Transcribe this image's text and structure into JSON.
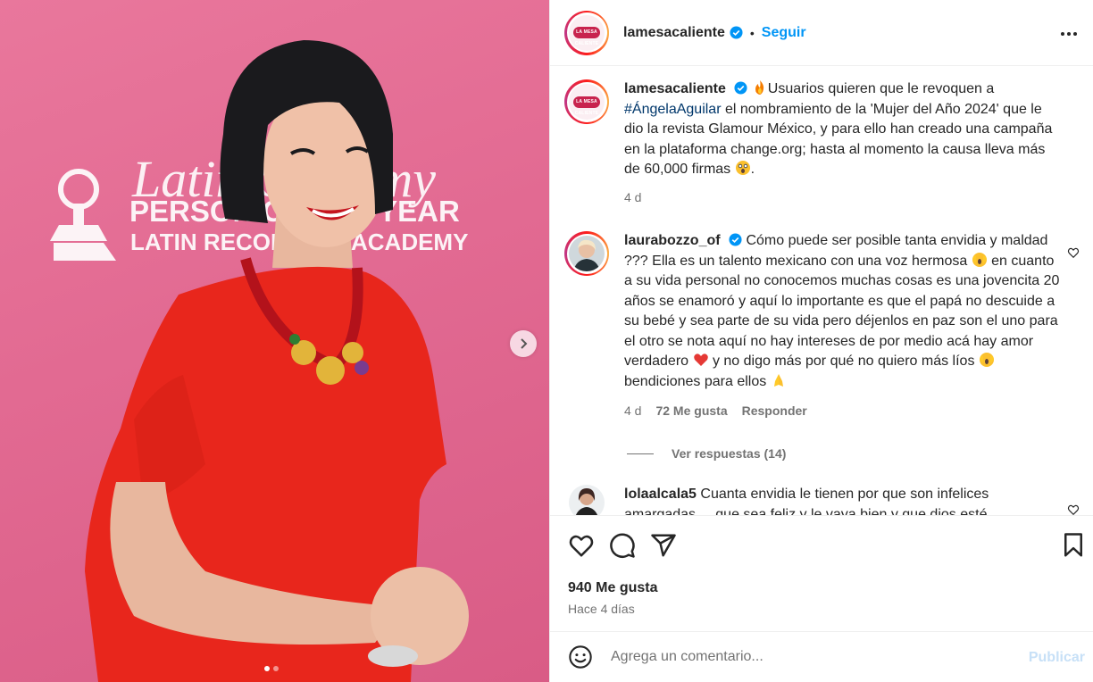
{
  "post": {
    "author": {
      "username": "lamesacaliente",
      "follow_label": "Seguir",
      "separator": "•",
      "logo_text": "LA MESA CALIENTE"
    },
    "image_text": {
      "line1": "Latin Grammy",
      "line2": "PERSON OF THE YEAR",
      "line3": "LATIN RECORDING ACADEMY"
    },
    "carousel": {
      "current": 1,
      "total": 2
    },
    "caption": {
      "username": "lamesacaliente",
      "before_tag": "Usuarios quieren que le revoquen a ",
      "hashtag": "#ÁngelaAguilar",
      "after_tag": " el nombramiento de la 'Mujer del Año 2024' que le dio la revista Glamour México, y para ello han creado una campaña en la plataforma change.org; hasta al momento la causa lleva más de 60,000 firmas ",
      "end": ".",
      "time": "4 d"
    },
    "comments": [
      {
        "username": "laurabozzo_of",
        "p1": "Cómo puede ser posible tanta envidia y maldad ??? Ella es un talento mexicano con una voz hermosa ",
        "p2": " en cuanto a su vida personal no conocemos muchas cosas es una jovencita 20 años se enamoró y aquí lo importante es que el papá no descuide a su bebé y sea parte de su vida pero déjenlos en paz son el uno para el otro se nota aquí no hay intereses de por medio acá hay amor verdadero ",
        "p3": " y no digo más por qué no quiero más líos ",
        "p4": " bendiciones para ellos ",
        "time": "4 d",
        "likes": "72 Me gusta",
        "reply": "Responder",
        "view_replies": "Ver respuestas (14)"
      },
      {
        "username": "lolaalcala5",
        "text": "Cuanta envidia le tienen por que son infelices",
        "overflow_text": "amargadas ... que sea feliz y le vaya bien y que dios esté"
      }
    ],
    "likes": "940 Me gusta",
    "posted": "Hace 4 días",
    "comment_input": {
      "placeholder": "Agrega un comentario...",
      "publish": "Publicar"
    }
  },
  "colors": {
    "accent": "#0095f6",
    "text": "#262626",
    "muted": "#737373",
    "background_pink": "#e26a92",
    "dress_red": "#e8261c"
  }
}
